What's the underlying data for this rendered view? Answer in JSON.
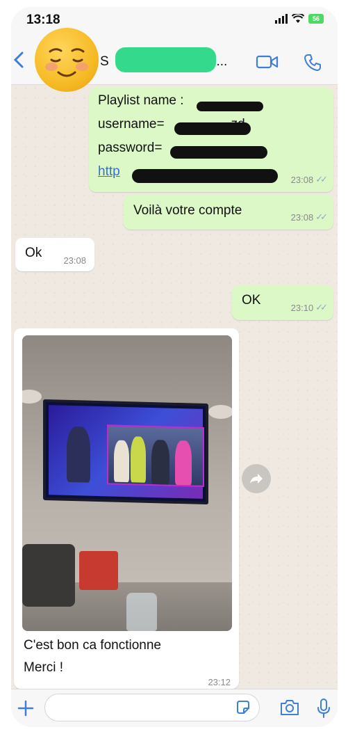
{
  "status_bar": {
    "time": "13:18",
    "battery": "56"
  },
  "header": {
    "contact_name_visible": "S",
    "contact_name_suffix": "ie..."
  },
  "messages": [
    {
      "direction": "out",
      "lines": [
        "Playlist name : ",
        "username=",
        "password=",
        "http"
      ],
      "line_tail_2": "zd",
      "time": "23:08",
      "ticks": "✓✓"
    },
    {
      "direction": "out",
      "text": "Voilà votre compte",
      "time": "23:08",
      "ticks": "✓✓"
    },
    {
      "direction": "in",
      "text": "Ok",
      "time": "23:08"
    },
    {
      "direction": "out",
      "text": "OK",
      "time": "23:10",
      "ticks": "✓✓"
    },
    {
      "direction": "in",
      "type": "image",
      "caption_line1": "C'est bon ca fonctionne",
      "caption_line2": "Merci !",
      "time": "23:12"
    }
  ],
  "icons": {
    "back": "chevron-left-icon",
    "video": "video-call-icon",
    "call": "phone-icon",
    "forward": "forward-icon",
    "plus": "plus-icon",
    "sticker": "sticker-icon",
    "camera": "camera-icon",
    "mic": "microphone-icon"
  },
  "colors": {
    "outgoing_bubble": "#dcf8c6",
    "incoming_bubble": "#ffffff",
    "accent": "#3e7ed8",
    "redaction_green": "#35d98c"
  }
}
